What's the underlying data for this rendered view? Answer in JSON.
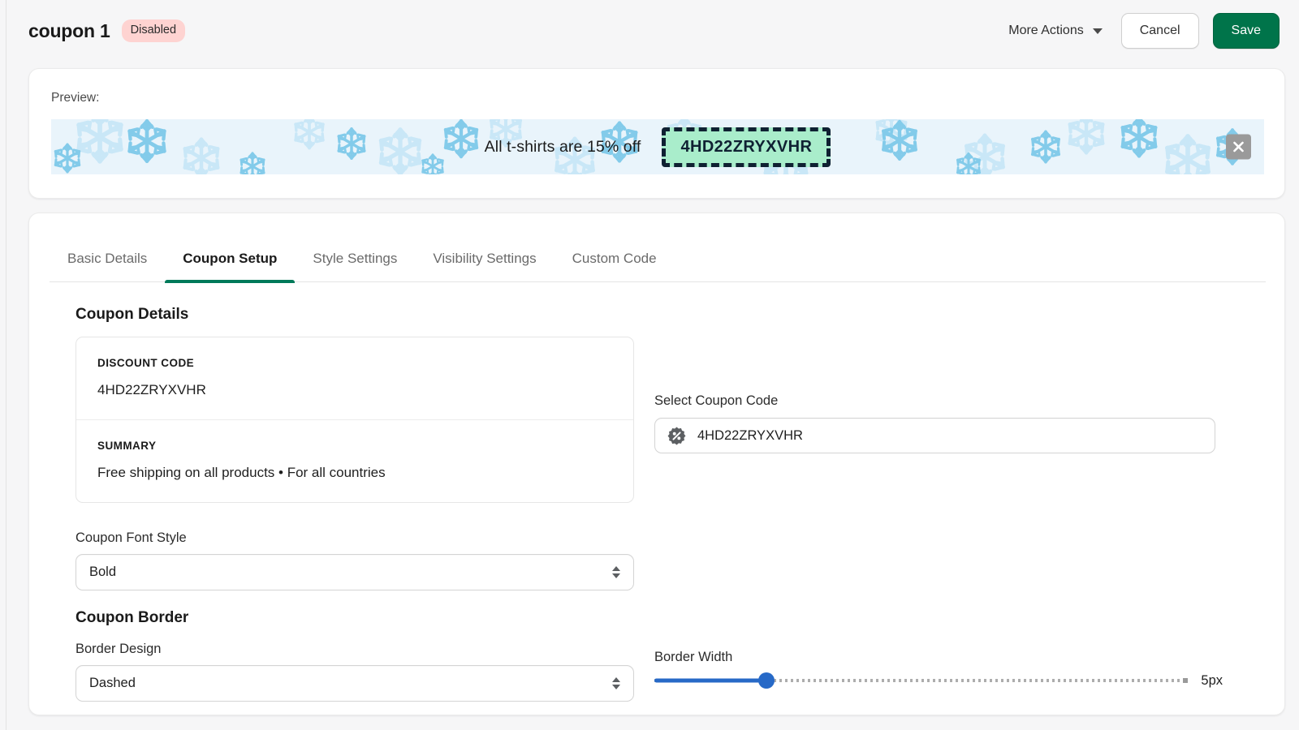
{
  "header": {
    "title": "coupon 1",
    "status_badge": "Disabled",
    "more_actions_label": "More Actions",
    "cancel_label": "Cancel",
    "save_label": "Save",
    "save_color": "#00744a",
    "badge_color": "#fed3d1"
  },
  "preview": {
    "label": "Preview:",
    "banner_text": "All t-shirts are 15% off",
    "coupon_code": "4HD22ZRYXVHR",
    "banner_bg": "#e9f4fb",
    "chip_bg": "#a9edcb",
    "chip_border_color": "#0f2132",
    "close_icon": "close-icon"
  },
  "tabs": [
    {
      "label": "Basic Details",
      "active": false
    },
    {
      "label": "Coupon Setup",
      "active": true
    },
    {
      "label": "Style Settings",
      "active": false
    },
    {
      "label": "Visibility Settings",
      "active": false
    },
    {
      "label": "Custom Code",
      "active": false
    }
  ],
  "tab_accent": "#007a5a",
  "coupon_details": {
    "heading": "Coupon Details",
    "rows": [
      {
        "key": "DISCOUNT CODE",
        "value": "4HD22ZRYXVHR"
      },
      {
        "key": "SUMMARY",
        "value": "Free shipping on all products • For all countries"
      }
    ]
  },
  "select_coupon": {
    "label": "Select Coupon Code",
    "value": "4HD22ZRYXVHR",
    "icon": "discount-badge-icon"
  },
  "font_style": {
    "label": "Coupon Font Style",
    "value": "Bold",
    "options": [
      "Bold"
    ]
  },
  "coupon_border": {
    "heading": "Coupon Border",
    "design_label": "Border Design",
    "design_value": "Dashed",
    "design_options": [
      "Dashed"
    ],
    "width_label": "Border Width",
    "width_value": "5px",
    "width_percent": 21,
    "slider_color": "#2769c7"
  }
}
